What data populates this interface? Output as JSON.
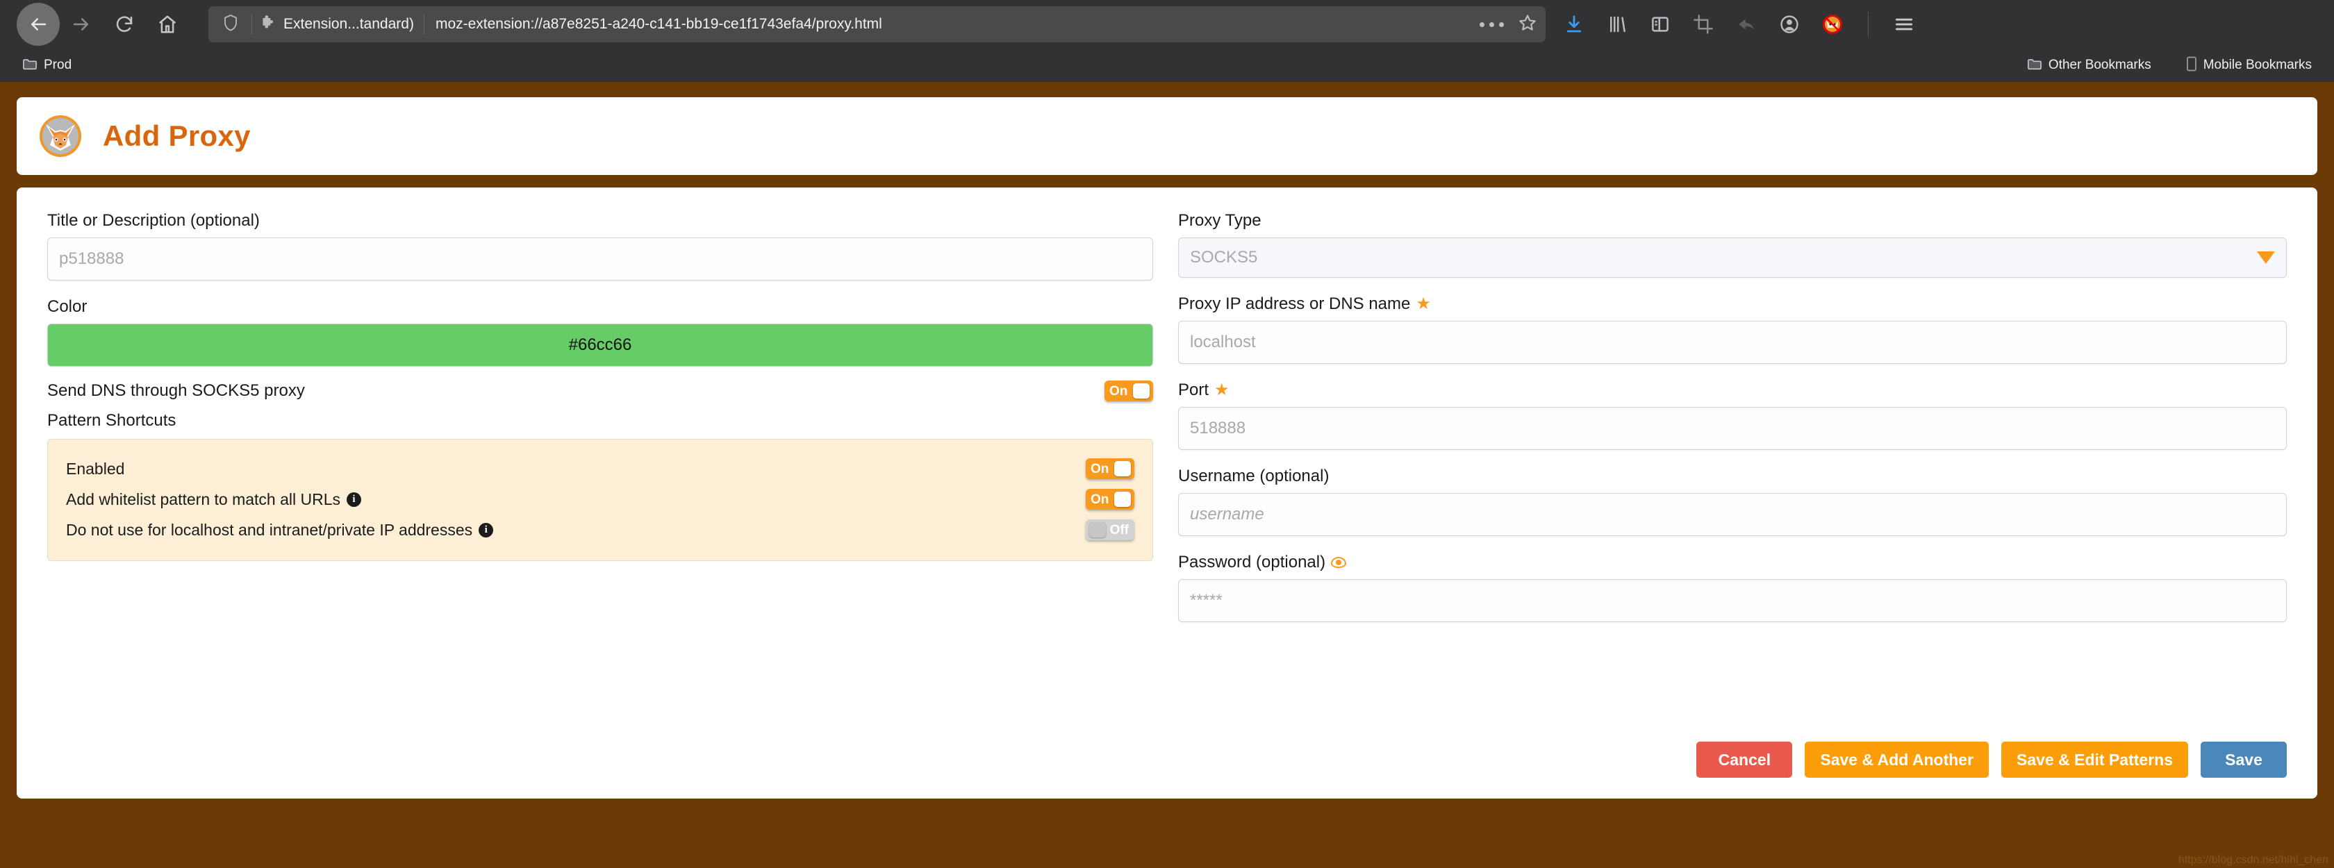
{
  "browser": {
    "nav": {
      "back_icon": "arrow-left-icon",
      "forward_icon": "arrow-right-icon",
      "reload_icon": "reload-icon",
      "home_icon": "home-icon"
    },
    "urlbar": {
      "shield_icon": "shield-icon",
      "extension_icon": "puzzle-piece-icon",
      "extension_label": "Extension...tandard)",
      "url": "moz-extension://a87e8251-a240-c141-bb19-ce1f1743efa4/proxy.html",
      "page_actions_icon": "ellipsis-icon",
      "bookmark_star_icon": "star-outline-icon"
    },
    "toolbar_icons": [
      "download-icon",
      "library-icon",
      "sidebar-icon",
      "screenshot-crop-icon",
      "undo-arrow-icon",
      "account-avatar-icon",
      "foxyproxy-disabled-icon",
      "hamburger-menu-icon"
    ],
    "bookmarks": {
      "left": [
        {
          "icon": "folder-icon",
          "label": "Prod"
        }
      ],
      "right": [
        {
          "icon": "folder-icon",
          "label": "Other Bookmarks"
        },
        {
          "icon": "mobile-device-icon",
          "label": "Mobile Bookmarks"
        }
      ]
    }
  },
  "header": {
    "logo_icon": "foxyproxy-fox-icon",
    "title": "Add Proxy",
    "title_color": "#d9660c"
  },
  "form": {
    "left": {
      "title_label": "Title or Description (optional)",
      "title_placeholder": "p518888",
      "color_label": "Color",
      "color_value": "#66cc66",
      "color_hex_text": "#66cc66",
      "dns_label": "Send DNS through SOCKS5 proxy",
      "dns_toggle": "On",
      "pattern_section_label": "Pattern Shortcuts",
      "pattern_rows": [
        {
          "label": "Enabled",
          "info": false,
          "toggle": "On"
        },
        {
          "label": "Add whitelist pattern to match all URLs",
          "info": true,
          "toggle": "On"
        },
        {
          "label": "Do not use for localhost and intranet/private IP addresses",
          "info": true,
          "toggle": "Off"
        }
      ]
    },
    "right": {
      "proxy_type_label": "Proxy Type",
      "proxy_type_value": "SOCKS5",
      "proxy_type_options": [
        "SOCKS5"
      ],
      "host_label": "Proxy IP address or DNS name",
      "host_required": true,
      "host_placeholder": "localhost",
      "port_label": "Port",
      "port_required": true,
      "port_placeholder": "518888",
      "username_label": "Username (optional)",
      "username_placeholder": "username",
      "password_label": "Password (optional)",
      "password_placeholder": "*****",
      "password_eye_icon": "eye-icon"
    }
  },
  "buttons": {
    "cancel": "Cancel",
    "save_add_another": "Save & Add Another",
    "save_edit_patterns": "Save & Edit Patterns",
    "save": "Save",
    "cancel_color": "#ea5a4c",
    "orange_color": "#fb9e09",
    "save_color": "#4b87b8"
  },
  "watermark": "https://blog.csdn.net/hihi_chen"
}
